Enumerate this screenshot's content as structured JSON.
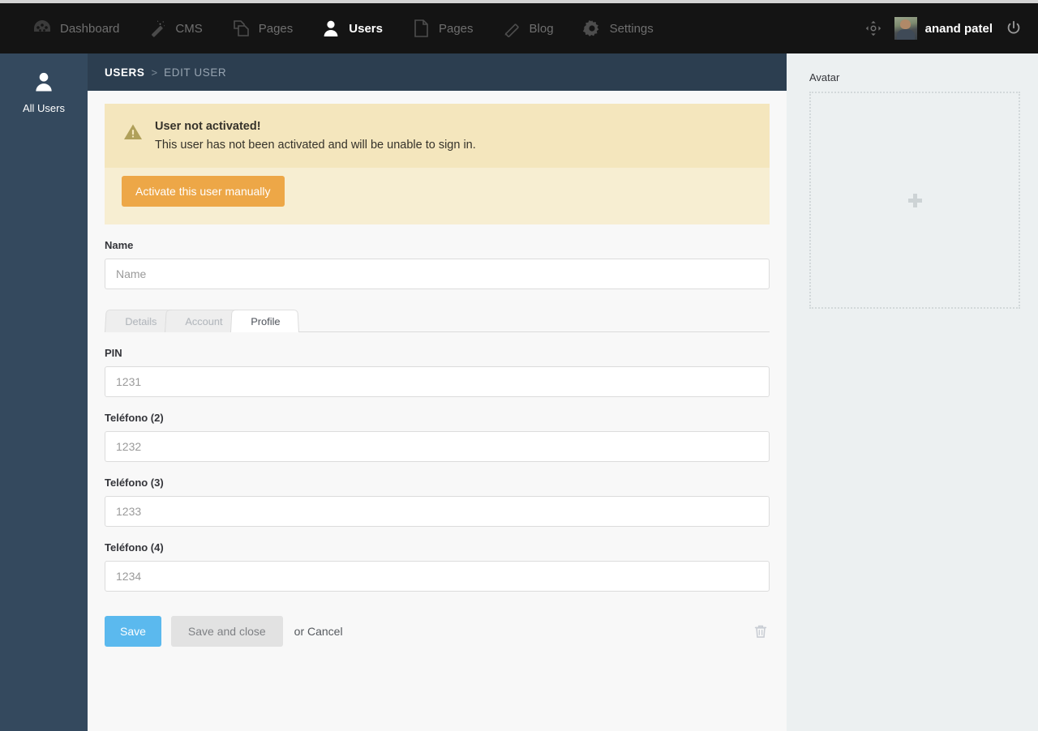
{
  "topnav": {
    "items": [
      {
        "label": "Dashboard",
        "icon": "dashboard-icon",
        "active": false
      },
      {
        "label": "CMS",
        "icon": "magic-wand-icon",
        "active": false
      },
      {
        "label": "Pages",
        "icon": "copy-pages-icon",
        "active": false
      },
      {
        "label": "Users",
        "icon": "user-icon",
        "active": true
      },
      {
        "label": "Pages",
        "icon": "document-icon",
        "active": false
      },
      {
        "label": "Blog",
        "icon": "pencil-icon",
        "active": false
      },
      {
        "label": "Settings",
        "icon": "gear-icon",
        "active": false
      }
    ],
    "move_icon": "move-crosshair-icon",
    "user_name": "anand patel",
    "avatar_icon": "user-avatar-thumbnail",
    "power_icon": "power-icon"
  },
  "sidebar": {
    "items": [
      {
        "label": "All Users",
        "icon": "user-icon"
      }
    ]
  },
  "breadcrumb": {
    "root": "USERS",
    "separator": ">",
    "current": "EDIT USER"
  },
  "alert": {
    "icon": "warning-triangle-icon",
    "title": "User not activated!",
    "message": "This user has not been activated and will be unable to sign in.",
    "button_label": "Activate this user manually"
  },
  "form": {
    "name": {
      "label": "Name",
      "value": "",
      "placeholder": "Name"
    },
    "tabs": [
      {
        "label": "Details",
        "active": false
      },
      {
        "label": "Account",
        "active": false
      },
      {
        "label": "Profile",
        "active": true
      }
    ],
    "fields": [
      {
        "label": "PIN",
        "value": "",
        "placeholder": "1231"
      },
      {
        "label": "Teléfono (2)",
        "value": "",
        "placeholder": "1232"
      },
      {
        "label": "Teléfono (3)",
        "value": "",
        "placeholder": "1233"
      },
      {
        "label": "Teléfono (4)",
        "value": "",
        "placeholder": "1234"
      }
    ]
  },
  "actions": {
    "save_label": "Save",
    "save_close_label": "Save and close",
    "or_text": "or ",
    "cancel_label": "Cancel",
    "delete_icon": "trash-icon"
  },
  "right_panel": {
    "label": "Avatar",
    "dropzone_icon": "plus-icon"
  },
  "colors": {
    "accent_blue": "#5bb9ee",
    "sidebar": "#34495e",
    "breadcrumb_bar": "#2c3e50",
    "topnav": "#141414",
    "alert_bg": "#f4e6bd",
    "alert_button": "#eda747",
    "right_panel_bg": "#ecf0f1"
  }
}
